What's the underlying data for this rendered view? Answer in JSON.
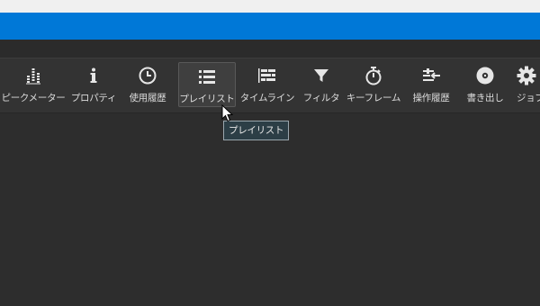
{
  "toolbar": {
    "items": [
      {
        "label": "ピークメーター",
        "icon": "peak-meter-icon"
      },
      {
        "label": "プロパティ",
        "icon": "info-icon"
      },
      {
        "label": "使用履歴",
        "icon": "clock-icon"
      },
      {
        "label": "プレイリスト",
        "icon": "list-icon"
      },
      {
        "label": "タイムライン",
        "icon": "timeline-icon"
      },
      {
        "label": "フィルタ",
        "icon": "filter-icon"
      },
      {
        "label": "キーフレーム",
        "icon": "stopwatch-icon"
      },
      {
        "label": "操作履歴",
        "icon": "history-icon"
      },
      {
        "label": "書き出し",
        "icon": "disc-icon"
      },
      {
        "label": "ジョブ",
        "icon": "gear-icon"
      }
    ]
  },
  "tooltip": {
    "text": "プレイリスト"
  },
  "colors": {
    "accent": "#0078d7",
    "background": "#2d2d2d",
    "toolbar": "#333333",
    "tooltip_bg": "#2c3e46"
  }
}
